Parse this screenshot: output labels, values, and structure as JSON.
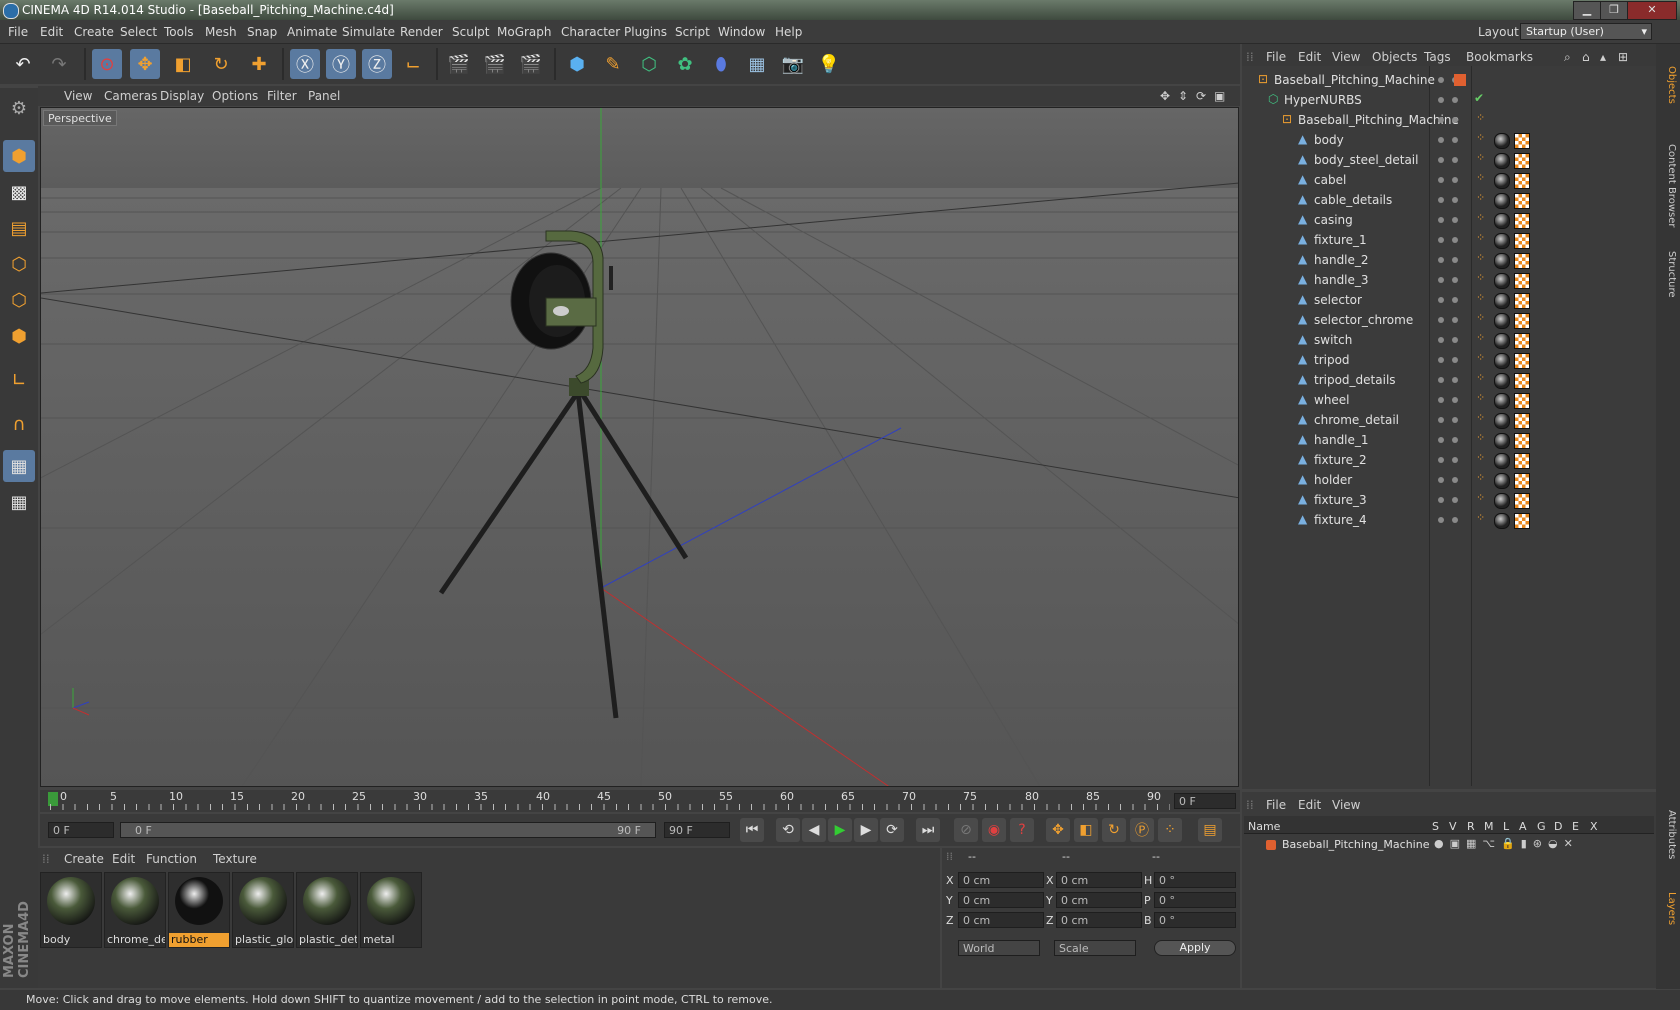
{
  "window": {
    "title": "CINEMA 4D R14.014 Studio - [Baseball_Pitching_Machine.c4d]",
    "layout_label": "Layout:",
    "layout_value": "Startup (User)"
  },
  "menubar": [
    "File",
    "Edit",
    "Create",
    "Select",
    "Tools",
    "Mesh",
    "Snap",
    "Animate",
    "Simulate",
    "Render",
    "Sculpt",
    "MoGraph",
    "Character",
    "Plugins",
    "Script",
    "Window",
    "Help"
  ],
  "viewport": {
    "menu": [
      "View",
      "Cameras",
      "Display",
      "Options",
      "Filter",
      "Panel"
    ],
    "label": "Perspective"
  },
  "timeline": {
    "ticks": [
      "0",
      "5",
      "10",
      "15",
      "20",
      "25",
      "30",
      "35",
      "40",
      "45",
      "50",
      "55",
      "60",
      "65",
      "70",
      "75",
      "80",
      "85",
      "90"
    ],
    "current_frame": "0 F",
    "start_field": "0 F",
    "range_start": "0 F",
    "range_end": "90 F",
    "end_field": "90 F"
  },
  "materials": {
    "menu": [
      "Create",
      "Edit",
      "Function",
      "Texture"
    ],
    "items": [
      {
        "name": "body",
        "selected": false,
        "color": "#4a5a3a"
      },
      {
        "name": "chrome_de",
        "selected": false,
        "color": "#4a5a3a"
      },
      {
        "name": "rubber",
        "selected": true,
        "color": "#111111"
      },
      {
        "name": "plastic_glo",
        "selected": false,
        "color": "#4a5a3a"
      },
      {
        "name": "plastic_det",
        "selected": false,
        "color": "#4a5a3a"
      },
      {
        "name": "metal",
        "selected": false,
        "color": "#4a5a3a"
      }
    ]
  },
  "coordinates": {
    "headers": [
      "--",
      "--",
      "--"
    ],
    "rows": [
      {
        "a": "X",
        "av": "0 cm",
        "b": "X",
        "bv": "0 cm",
        "c": "H",
        "cv": "0 °"
      },
      {
        "a": "Y",
        "av": "0 cm",
        "b": "Y",
        "bv": "0 cm",
        "c": "P",
        "cv": "0 °"
      },
      {
        "a": "Z",
        "av": "0 cm",
        "b": "Z",
        "bv": "0 cm",
        "c": "B",
        "cv": "0 °"
      }
    ],
    "mode1": "World",
    "mode2": "Scale",
    "apply": "Apply"
  },
  "objects": {
    "menu": [
      "File",
      "Edit",
      "View",
      "Objects",
      "Tags",
      "Bookmarks"
    ],
    "root": "Baseball_Pitching_Machine",
    "hypernurbs": "HyperNURBS",
    "group": "Baseball_Pitching_Machine",
    "children": [
      "body",
      "body_steel_detail",
      "cabel",
      "cable_details",
      "casing",
      "fixture_1",
      "handle_2",
      "handle_3",
      "selector",
      "selector_chrome",
      "switch",
      "tripod",
      "tripod_details",
      "wheel",
      "chrome_detail",
      "handle_1",
      "fixture_2",
      "holder",
      "fixture_3",
      "fixture_4"
    ]
  },
  "layers": {
    "menu": [
      "File",
      "Edit",
      "View"
    ],
    "headers": [
      "Name",
      "S",
      "V",
      "R",
      "M",
      "L",
      "A",
      "G",
      "D",
      "E",
      "X"
    ],
    "row": "Baseball_Pitching_Machine"
  },
  "right_tabs": [
    "Objects",
    "Content Browser",
    "Structure",
    "Attributes",
    "Layers"
  ],
  "status": "Move: Click and drag to move elements. Hold down SHIFT to quantize movement / add to the selection in point mode, CTRL to remove.",
  "colors": {
    "accent": "#f0a030",
    "selected_material": "#f0a030",
    "axis_x": "#c03030",
    "axis_y": "#30a030",
    "axis_z": "#3040c0"
  }
}
